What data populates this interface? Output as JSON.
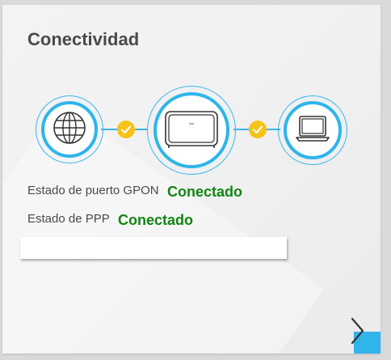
{
  "card": {
    "title": "Conectividad"
  },
  "diagram": {
    "nodes": [
      {
        "name": "internet",
        "icon": "globe-icon"
      },
      {
        "name": "router",
        "icon": "router-icon"
      },
      {
        "name": "computer",
        "icon": "laptop-icon"
      }
    ],
    "links": [
      {
        "status_icon": "check-icon",
        "status": "ok"
      },
      {
        "status_icon": "check-icon",
        "status": "ok"
      }
    ]
  },
  "status": {
    "gpon_label": "Estado de puerto GPON",
    "gpon_value": "Conectado",
    "ppp_label": "Estado de PPP",
    "ppp_value": "Conectado"
  },
  "colors": {
    "accent": "#2fb5ea",
    "ok": "#128512",
    "check": "#f6c217"
  },
  "navigation": {
    "next_icon": "chevron-right-icon"
  }
}
